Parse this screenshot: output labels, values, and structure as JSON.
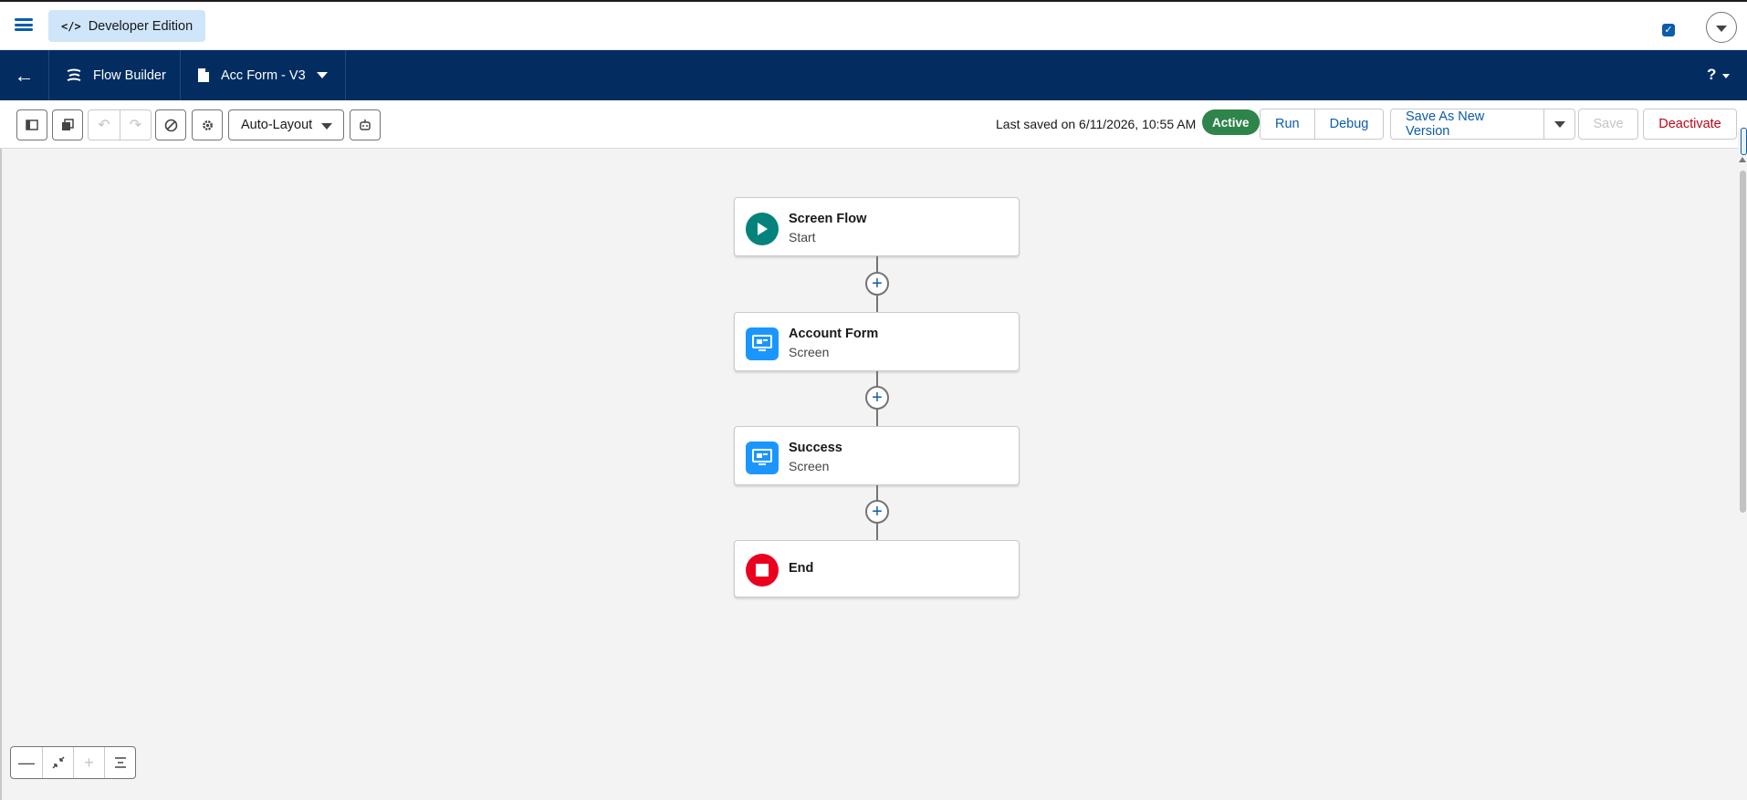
{
  "topbar": {
    "edition_label": "Developer Edition",
    "edition_icon": "code-icon",
    "checkbox_checked": true
  },
  "appbar": {
    "app_label": "Flow Builder",
    "flow_label": "Acc Form - V3",
    "help_label": "?"
  },
  "toolbar": {
    "layout_select_value": "Auto-Layout",
    "saved_text": "Last saved on 6/11/2026, 10:55 AM",
    "status_badge": "Active",
    "run_label": "Run",
    "debug_label": "Debug",
    "save_new_version_label": "Save As New Version",
    "save_label": "Save",
    "deactivate_label": "Deactivate"
  },
  "flow": {
    "nodes": [
      {
        "title": "Screen Flow",
        "subtitle": "Start",
        "icon": "play-icon",
        "color": "#06827c"
      },
      {
        "title": "Account Form",
        "subtitle": "Screen",
        "icon": "screen-icon",
        "color": "#1b96ff"
      },
      {
        "title": "Success",
        "subtitle": "Screen",
        "icon": "screen-icon",
        "color": "#1b96ff"
      },
      {
        "title": "End",
        "subtitle": "",
        "icon": "stop-icon",
        "color": "#ea001e"
      }
    ]
  },
  "colors": {
    "brand_navy": "#032d60",
    "link_blue": "#0b5cab",
    "active_green": "#2e844a",
    "deactivate_red": "#ba0517"
  }
}
